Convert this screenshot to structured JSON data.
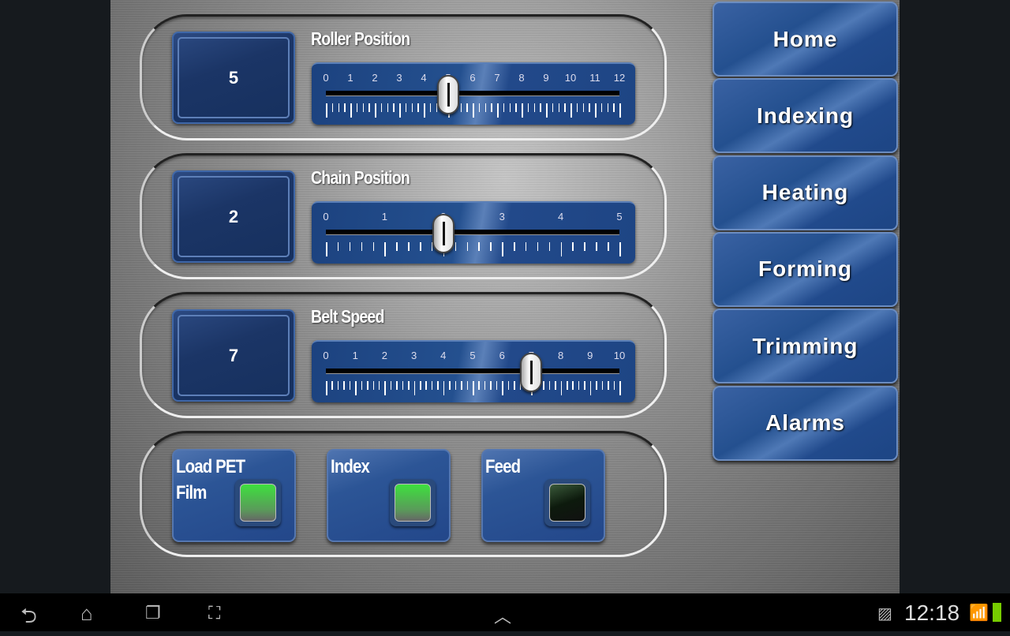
{
  "sliders": [
    {
      "title": "Roller Position",
      "value": "5",
      "min": 0,
      "max": 12,
      "minor_per_unit": 4,
      "labels": [
        "0",
        "1",
        "2",
        "3",
        "4",
        "5",
        "6",
        "7",
        "8",
        "9",
        "10",
        "11",
        "12"
      ]
    },
    {
      "title": "Chain Position",
      "value": "2",
      "min": 0,
      "max": 5,
      "minor_per_unit": 5,
      "labels": [
        "0",
        "1",
        "2",
        "3",
        "4",
        "5"
      ]
    },
    {
      "title": "Belt Speed",
      "value": "7",
      "min": 0,
      "max": 10,
      "minor_per_unit": 5,
      "labels": [
        "0",
        "1",
        "2",
        "3",
        "4",
        "5",
        "6",
        "7",
        "8",
        "9",
        "10"
      ]
    }
  ],
  "buttons": [
    {
      "label": "Load PET Film",
      "indicator": "on"
    },
    {
      "label": "Index",
      "indicator": "on"
    },
    {
      "label": "Feed",
      "indicator": "off"
    }
  ],
  "nav": [
    {
      "label": "Home"
    },
    {
      "label": "Indexing"
    },
    {
      "label": "Heating"
    },
    {
      "label": "Forming"
    },
    {
      "label": "Trimming"
    },
    {
      "label": "Alarms"
    }
  ],
  "status_bar": {
    "time": "12:18",
    "icons": [
      "back-icon",
      "home-icon",
      "recent-apps-icon",
      "screenshot-icon",
      "up-chevron-icon",
      "gallery-icon",
      "wifi-icon",
      "battery-icon"
    ]
  },
  "colors": {
    "led_on": "#3ee03e",
    "led_off": "#0d1a0d",
    "accent": "#24508f"
  }
}
